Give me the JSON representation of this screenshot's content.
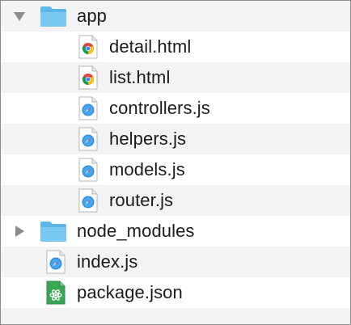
{
  "tree": {
    "items": [
      {
        "name": "app",
        "type": "folder",
        "expanded": true,
        "icon": "folder-icon"
      },
      {
        "name": "detail.html",
        "type": "file",
        "icon": "chrome-html-file-icon"
      },
      {
        "name": "list.html",
        "type": "file",
        "icon": "chrome-html-file-icon"
      },
      {
        "name": "controllers.js",
        "type": "file",
        "icon": "safari-js-file-icon"
      },
      {
        "name": "helpers.js",
        "type": "file",
        "icon": "safari-js-file-icon"
      },
      {
        "name": "models.js",
        "type": "file",
        "icon": "safari-js-file-icon"
      },
      {
        "name": "router.js",
        "type": "file",
        "icon": "safari-js-file-icon"
      },
      {
        "name": "node_modules",
        "type": "folder",
        "expanded": false,
        "icon": "folder-icon"
      },
      {
        "name": "index.js",
        "type": "file",
        "icon": "safari-js-file-icon"
      },
      {
        "name": "package.json",
        "type": "file",
        "icon": "atom-json-file-icon"
      }
    ]
  },
  "colors": {
    "folder": "#6cc2ef",
    "stripe": "#f3f3f3",
    "disclosure": "#888888",
    "compass": "#2a8fe3",
    "atom": "#3aa655"
  }
}
